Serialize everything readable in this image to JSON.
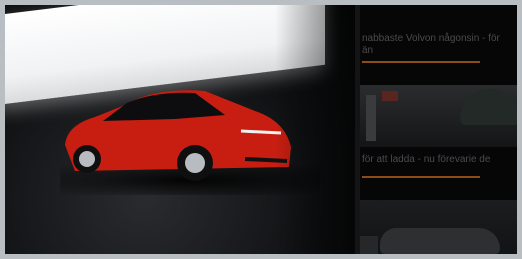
{
  "hero": {
    "image_subject": "red-hatchback-car-in-studio",
    "car_color": "#c81e12"
  },
  "side_cards": [
    {
      "text_line1": "nabbaste Volvon någonsin - för",
      "text_line2": "än"
    },
    {
      "text_line1": "för att ladda - nu förevarie de",
      "text_line2": ""
    },
    {
      "text_line1": "",
      "text_line2": ""
    }
  ],
  "colors": {
    "accent": "#8a4e14",
    "frame": "#b9bec3"
  }
}
